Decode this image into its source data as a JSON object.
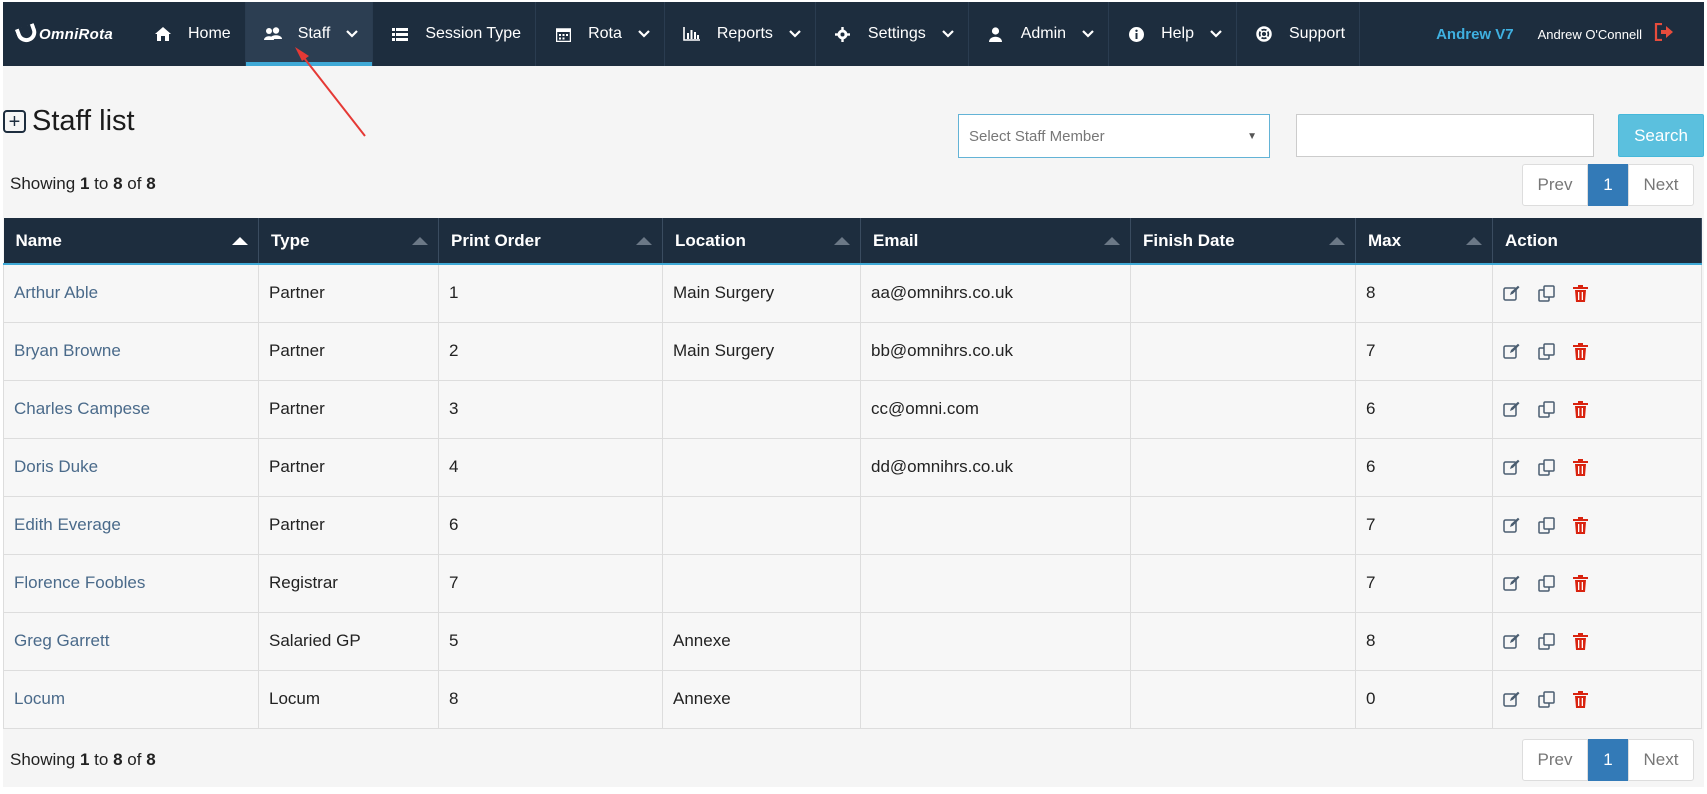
{
  "nav": {
    "brand": "OmniRota",
    "items": [
      {
        "label": "Home",
        "icon": "home-icon",
        "chevron": false
      },
      {
        "label": "Staff",
        "icon": "users-icon",
        "chevron": true,
        "active": true
      },
      {
        "label": "Session Type",
        "icon": "list-icon",
        "chevron": false
      },
      {
        "label": "Rota",
        "icon": "calendar-icon",
        "chevron": true
      },
      {
        "label": "Reports",
        "icon": "bar-chart-icon",
        "chevron": true
      },
      {
        "label": "Settings",
        "icon": "gear-icon",
        "chevron": true
      },
      {
        "label": "Admin",
        "icon": "user-icon",
        "chevron": true
      },
      {
        "label": "Help",
        "icon": "info-icon",
        "chevron": true
      },
      {
        "label": "Support",
        "icon": "lifebuoy-icon",
        "chevron": false
      }
    ],
    "user_tag": "Andrew V7",
    "user_name": "Andrew O'Connell",
    "accent": "#3fa9d6",
    "bg": "#1d2d3e"
  },
  "page": {
    "title": "Staff list",
    "select_placeholder": "Select Staff Member",
    "search_label": "Search",
    "showing": {
      "from": "1",
      "to": "8",
      "total": "8",
      "word_showing": "Showing",
      "word_to": "to",
      "word_of": "of"
    },
    "pager": {
      "prev": "Prev",
      "current": "1",
      "next": "Next"
    }
  },
  "table": {
    "columns": [
      "Name",
      "Type",
      "Print Order",
      "Location",
      "Email",
      "Finish Date",
      "Max",
      "Action"
    ],
    "rows": [
      {
        "name": "Arthur Able",
        "type": "Partner",
        "print_order": "1",
        "location": "Main Surgery",
        "email": "aa@omnihrs.co.uk",
        "finish_date": "",
        "max": "8"
      },
      {
        "name": "Bryan Browne",
        "type": "Partner",
        "print_order": "2",
        "location": "Main Surgery",
        "email": "bb@omnihrs.co.uk",
        "finish_date": "",
        "max": "7"
      },
      {
        "name": "Charles Campese",
        "type": "Partner",
        "print_order": "3",
        "location": "",
        "email": "cc@omni.com",
        "finish_date": "",
        "max": "6"
      },
      {
        "name": "Doris Duke",
        "type": "Partner",
        "print_order": "4",
        "location": "",
        "email": "dd@omnihrs.co.uk",
        "finish_date": "",
        "max": "6"
      },
      {
        "name": "Edith Everage",
        "type": "Partner",
        "print_order": "6",
        "location": "",
        "email": "",
        "finish_date": "",
        "max": "7"
      },
      {
        "name": "Florence Foobles",
        "type": "Registrar",
        "print_order": "7",
        "location": "",
        "email": "",
        "finish_date": "",
        "max": "7"
      },
      {
        "name": "Greg Garrett",
        "type": "Salaried GP",
        "print_order": "5",
        "location": "Annexe",
        "email": "",
        "finish_date": "",
        "max": "8"
      },
      {
        "name": "Locum",
        "type": "Locum",
        "print_order": "8",
        "location": "Annexe",
        "email": "",
        "finish_date": "",
        "max": "0"
      }
    ],
    "action_icons": [
      "edit-icon",
      "copy-icon",
      "delete-icon"
    ],
    "delete_color": "#d9230f"
  }
}
